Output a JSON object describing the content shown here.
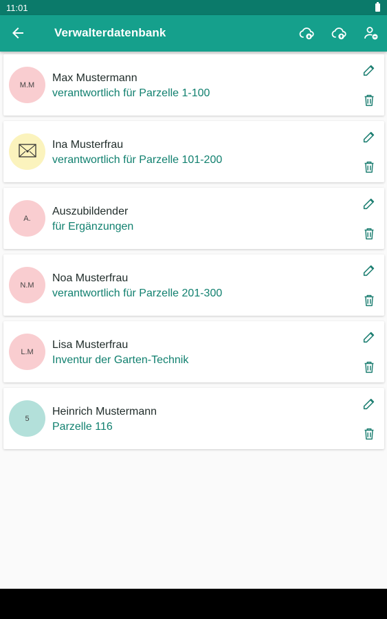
{
  "status_bar": {
    "time": "11:01"
  },
  "app_bar": {
    "title": "Verwalterdatenbank",
    "icons": [
      "arrow-back-icon",
      "cloud-download-icon",
      "cloud-upload-icon",
      "person-remove-icon"
    ]
  },
  "colors": {
    "status_bar": "#0b7a6a",
    "app_bar": "#15a08c",
    "accent_text": "#11806f",
    "icon": "#1e7f72"
  },
  "managers": [
    {
      "initials": "M.M",
      "name": "Max Mustermann",
      "subtitle": "verantwortlich für Parzelle 1-100",
      "avatar_color": "#f9cdd0",
      "avatar_icon": ""
    },
    {
      "initials": "",
      "name": "Ina Musterfrau",
      "subtitle": "verantwortlich für Parzelle 101-200",
      "avatar_color": "#fbf3bd",
      "avatar_icon": "envelope-icon"
    },
    {
      "initials": "A.",
      "name": "Auszubildender",
      "subtitle": "für Ergänzungen",
      "avatar_color": "#f9cdd0",
      "avatar_icon": ""
    },
    {
      "initials": "N.M",
      "name": "Noa Musterfrau",
      "subtitle": "verantwortlich für Parzelle 201-300",
      "avatar_color": "#f9cdd0",
      "avatar_icon": ""
    },
    {
      "initials": "L.M",
      "name": "Lisa Musterfrau",
      "subtitle": "Inventur der Garten-Technik",
      "avatar_color": "#f9cdd0",
      "avatar_icon": ""
    },
    {
      "initials": "5",
      "name": "Heinrich Mustermann",
      "subtitle": "Parzelle 116",
      "avatar_color": "#b3e0da",
      "avatar_icon": ""
    }
  ]
}
